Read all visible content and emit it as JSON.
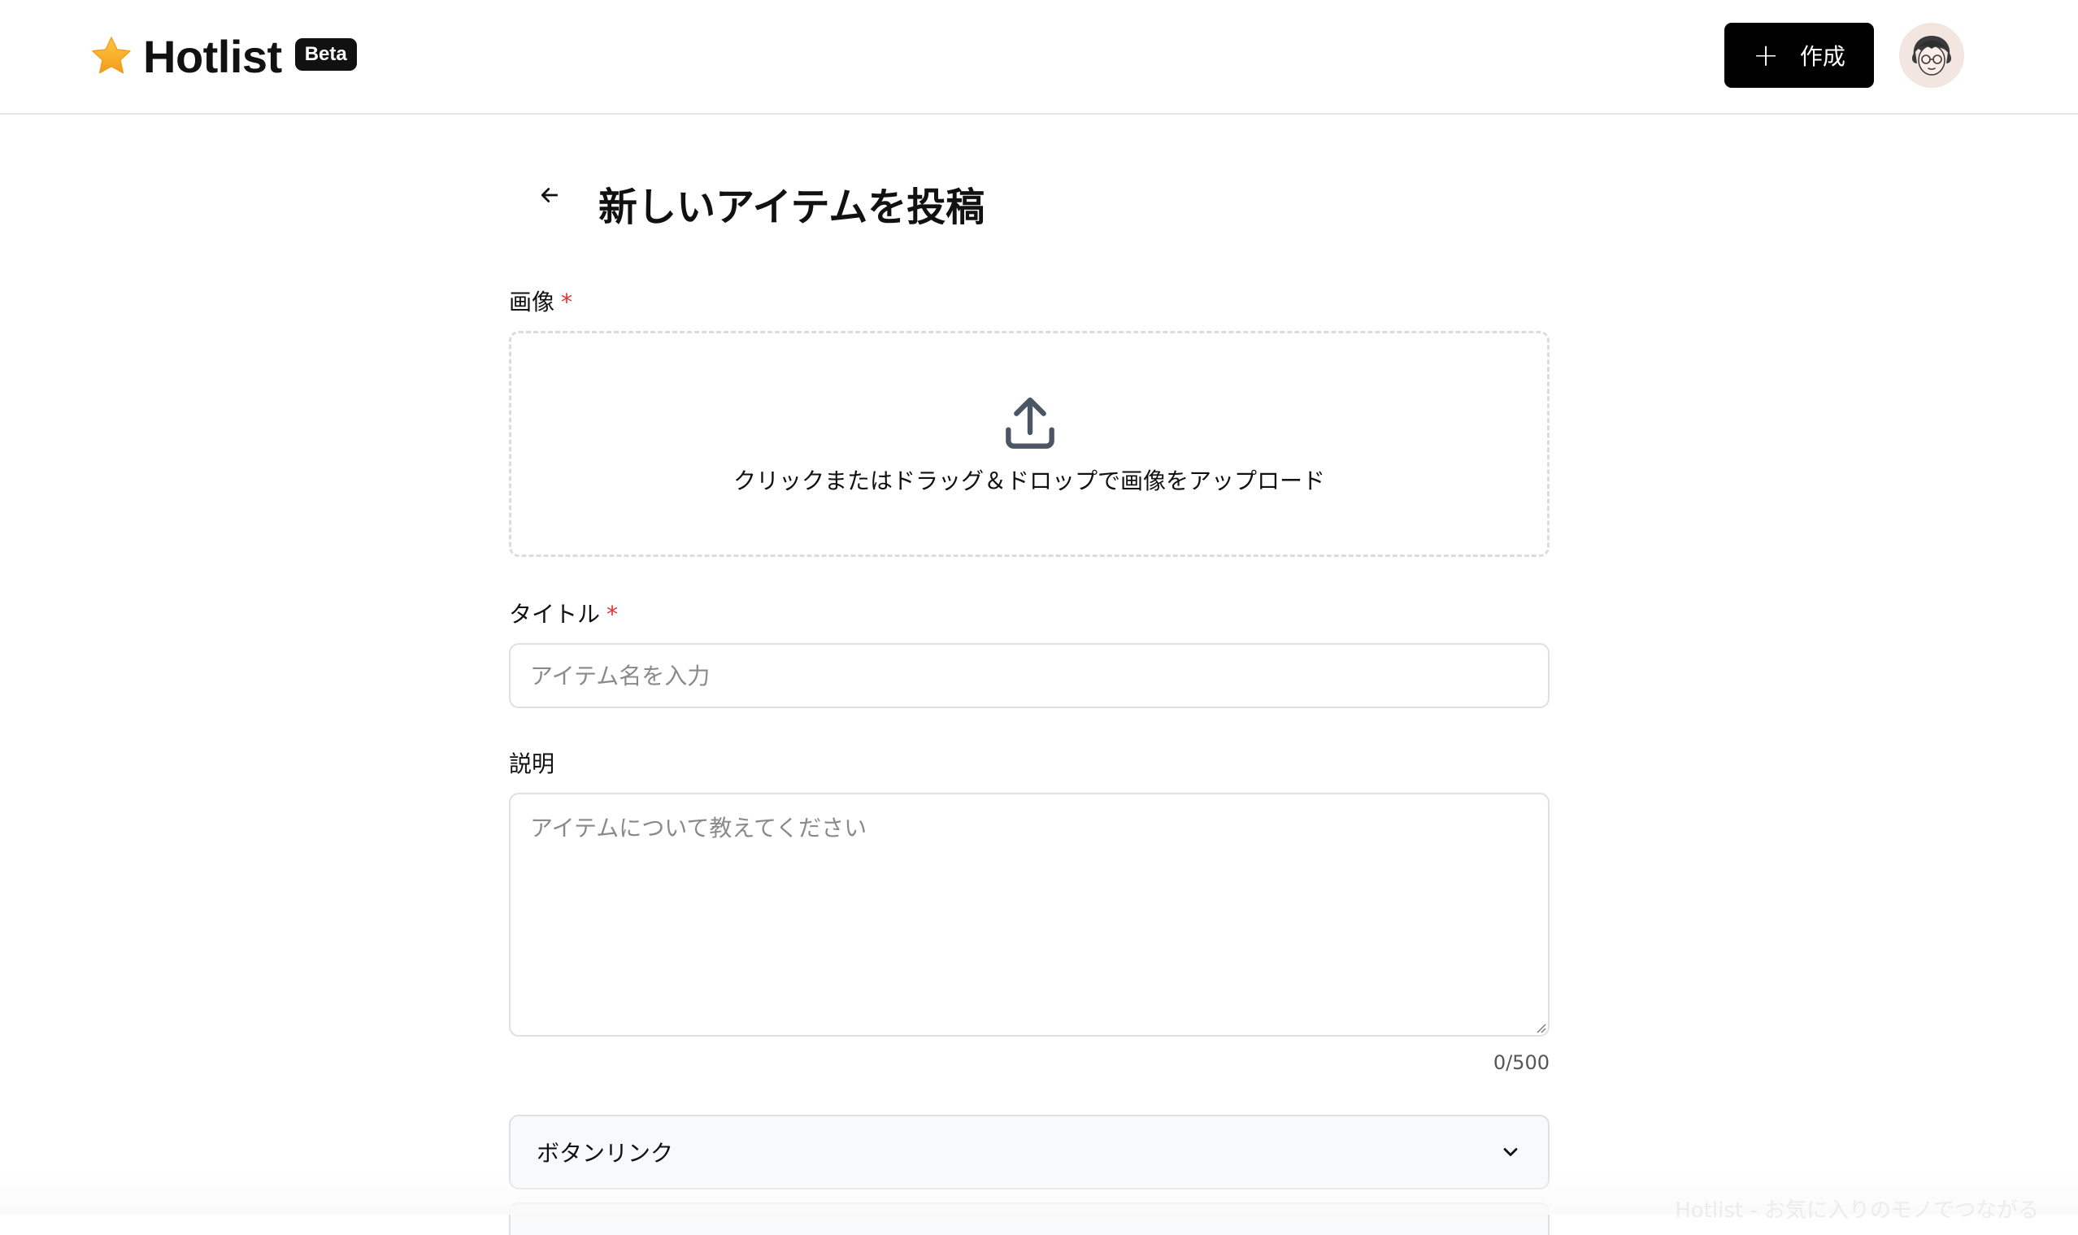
{
  "header": {
    "logo_text": "Hotlist",
    "beta_badge": "Beta",
    "create_button": "作成"
  },
  "page": {
    "title": "新しいアイテムを投稿",
    "image_label": "画像",
    "required_mark": "*",
    "dropzone_text": "クリックまたはドラッグ＆ドロップで画像をアップロード",
    "title_label": "タイトル",
    "title_placeholder": "アイテム名を入力",
    "description_label": "説明",
    "description_placeholder": "アイテムについて教えてください",
    "char_counter": "0/500",
    "button_link_label": "ボタンリンク"
  },
  "footer": {
    "tagline": "Hotlist - お気に入りのモノでつながる"
  }
}
